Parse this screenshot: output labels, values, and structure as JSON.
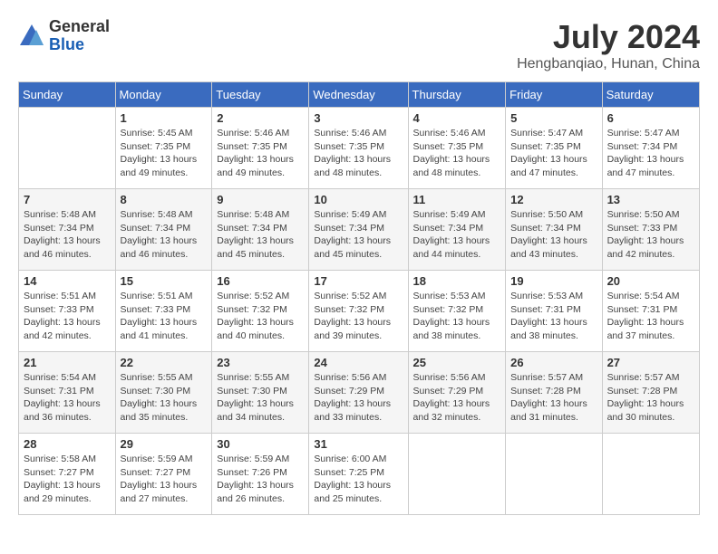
{
  "header": {
    "logo_general": "General",
    "logo_blue": "Blue",
    "month_title": "July 2024",
    "subtitle": "Hengbanqiao, Hunan, China"
  },
  "days_of_week": [
    "Sunday",
    "Monday",
    "Tuesday",
    "Wednesday",
    "Thursday",
    "Friday",
    "Saturday"
  ],
  "weeks": [
    [
      {
        "day": "",
        "info": ""
      },
      {
        "day": "1",
        "info": "Sunrise: 5:45 AM\nSunset: 7:35 PM\nDaylight: 13 hours\nand 49 minutes."
      },
      {
        "day": "2",
        "info": "Sunrise: 5:46 AM\nSunset: 7:35 PM\nDaylight: 13 hours\nand 49 minutes."
      },
      {
        "day": "3",
        "info": "Sunrise: 5:46 AM\nSunset: 7:35 PM\nDaylight: 13 hours\nand 48 minutes."
      },
      {
        "day": "4",
        "info": "Sunrise: 5:46 AM\nSunset: 7:35 PM\nDaylight: 13 hours\nand 48 minutes."
      },
      {
        "day": "5",
        "info": "Sunrise: 5:47 AM\nSunset: 7:35 PM\nDaylight: 13 hours\nand 47 minutes."
      },
      {
        "day": "6",
        "info": "Sunrise: 5:47 AM\nSunset: 7:34 PM\nDaylight: 13 hours\nand 47 minutes."
      }
    ],
    [
      {
        "day": "7",
        "info": "Sunrise: 5:48 AM\nSunset: 7:34 PM\nDaylight: 13 hours\nand 46 minutes."
      },
      {
        "day": "8",
        "info": "Sunrise: 5:48 AM\nSunset: 7:34 PM\nDaylight: 13 hours\nand 46 minutes."
      },
      {
        "day": "9",
        "info": "Sunrise: 5:48 AM\nSunset: 7:34 PM\nDaylight: 13 hours\nand 45 minutes."
      },
      {
        "day": "10",
        "info": "Sunrise: 5:49 AM\nSunset: 7:34 PM\nDaylight: 13 hours\nand 45 minutes."
      },
      {
        "day": "11",
        "info": "Sunrise: 5:49 AM\nSunset: 7:34 PM\nDaylight: 13 hours\nand 44 minutes."
      },
      {
        "day": "12",
        "info": "Sunrise: 5:50 AM\nSunset: 7:34 PM\nDaylight: 13 hours\nand 43 minutes."
      },
      {
        "day": "13",
        "info": "Sunrise: 5:50 AM\nSunset: 7:33 PM\nDaylight: 13 hours\nand 42 minutes."
      }
    ],
    [
      {
        "day": "14",
        "info": "Sunrise: 5:51 AM\nSunset: 7:33 PM\nDaylight: 13 hours\nand 42 minutes."
      },
      {
        "day": "15",
        "info": "Sunrise: 5:51 AM\nSunset: 7:33 PM\nDaylight: 13 hours\nand 41 minutes."
      },
      {
        "day": "16",
        "info": "Sunrise: 5:52 AM\nSunset: 7:32 PM\nDaylight: 13 hours\nand 40 minutes."
      },
      {
        "day": "17",
        "info": "Sunrise: 5:52 AM\nSunset: 7:32 PM\nDaylight: 13 hours\nand 39 minutes."
      },
      {
        "day": "18",
        "info": "Sunrise: 5:53 AM\nSunset: 7:32 PM\nDaylight: 13 hours\nand 38 minutes."
      },
      {
        "day": "19",
        "info": "Sunrise: 5:53 AM\nSunset: 7:31 PM\nDaylight: 13 hours\nand 38 minutes."
      },
      {
        "day": "20",
        "info": "Sunrise: 5:54 AM\nSunset: 7:31 PM\nDaylight: 13 hours\nand 37 minutes."
      }
    ],
    [
      {
        "day": "21",
        "info": "Sunrise: 5:54 AM\nSunset: 7:31 PM\nDaylight: 13 hours\nand 36 minutes."
      },
      {
        "day": "22",
        "info": "Sunrise: 5:55 AM\nSunset: 7:30 PM\nDaylight: 13 hours\nand 35 minutes."
      },
      {
        "day": "23",
        "info": "Sunrise: 5:55 AM\nSunset: 7:30 PM\nDaylight: 13 hours\nand 34 minutes."
      },
      {
        "day": "24",
        "info": "Sunrise: 5:56 AM\nSunset: 7:29 PM\nDaylight: 13 hours\nand 33 minutes."
      },
      {
        "day": "25",
        "info": "Sunrise: 5:56 AM\nSunset: 7:29 PM\nDaylight: 13 hours\nand 32 minutes."
      },
      {
        "day": "26",
        "info": "Sunrise: 5:57 AM\nSunset: 7:28 PM\nDaylight: 13 hours\nand 31 minutes."
      },
      {
        "day": "27",
        "info": "Sunrise: 5:57 AM\nSunset: 7:28 PM\nDaylight: 13 hours\nand 30 minutes."
      }
    ],
    [
      {
        "day": "28",
        "info": "Sunrise: 5:58 AM\nSunset: 7:27 PM\nDaylight: 13 hours\nand 29 minutes."
      },
      {
        "day": "29",
        "info": "Sunrise: 5:59 AM\nSunset: 7:27 PM\nDaylight: 13 hours\nand 27 minutes."
      },
      {
        "day": "30",
        "info": "Sunrise: 5:59 AM\nSunset: 7:26 PM\nDaylight: 13 hours\nand 26 minutes."
      },
      {
        "day": "31",
        "info": "Sunrise: 6:00 AM\nSunset: 7:25 PM\nDaylight: 13 hours\nand 25 minutes."
      },
      {
        "day": "",
        "info": ""
      },
      {
        "day": "",
        "info": ""
      },
      {
        "day": "",
        "info": ""
      }
    ]
  ]
}
